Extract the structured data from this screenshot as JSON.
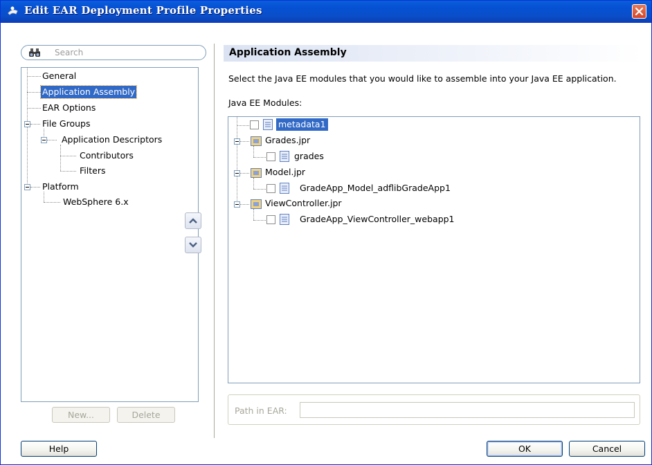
{
  "window": {
    "title": "Edit EAR Deployment Profile Properties"
  },
  "search": {
    "placeholder": "Search"
  },
  "nav_tree": {
    "items": [
      {
        "label": "General"
      },
      {
        "label": "Application Assembly",
        "selected": true
      },
      {
        "label": "EAR Options"
      },
      {
        "label": "File Groups"
      },
      {
        "label": "Application Descriptors"
      },
      {
        "label": "Contributors"
      },
      {
        "label": "Filters"
      },
      {
        "label": "Platform"
      },
      {
        "label": "WebSphere 6.x"
      }
    ]
  },
  "nav_buttons": {
    "new_label": "New...",
    "delete_label": "Delete"
  },
  "move_buttons": {
    "up_icon": "chevron-up-icon",
    "down_icon": "chevron-down-icon"
  },
  "panel": {
    "heading": "Application Assembly",
    "description": "Select the Java EE modules that you would like to assemble into your Java EE application.",
    "modules_label": "Java EE Modules:"
  },
  "modules_tree": {
    "items": [
      {
        "label": "metadata1",
        "type": "module",
        "checked": false,
        "selected": true
      },
      {
        "label": "Grades.jpr",
        "type": "project"
      },
      {
        "label": "grades",
        "type": "module",
        "checked": false
      },
      {
        "label": "Model.jpr",
        "type": "project"
      },
      {
        "label": "GradeApp_Model_adflibGradeApp1",
        "type": "module",
        "checked": false
      },
      {
        "label": "ViewController.jpr",
        "type": "project"
      },
      {
        "label": "GradeApp_ViewController_webapp1",
        "type": "module",
        "checked": false
      }
    ]
  },
  "path_in_ear": {
    "label": "Path in EAR:",
    "value": ""
  },
  "footer": {
    "help_label": "Help",
    "ok_label": "OK",
    "cancel_label": "Cancel"
  },
  "colors": {
    "title_bar": "#0a5fdb",
    "selection": "#3169c6",
    "close_button": "#d4462a",
    "folder_icon": "#f2d27a",
    "file_icon": "#8aa2d8"
  }
}
